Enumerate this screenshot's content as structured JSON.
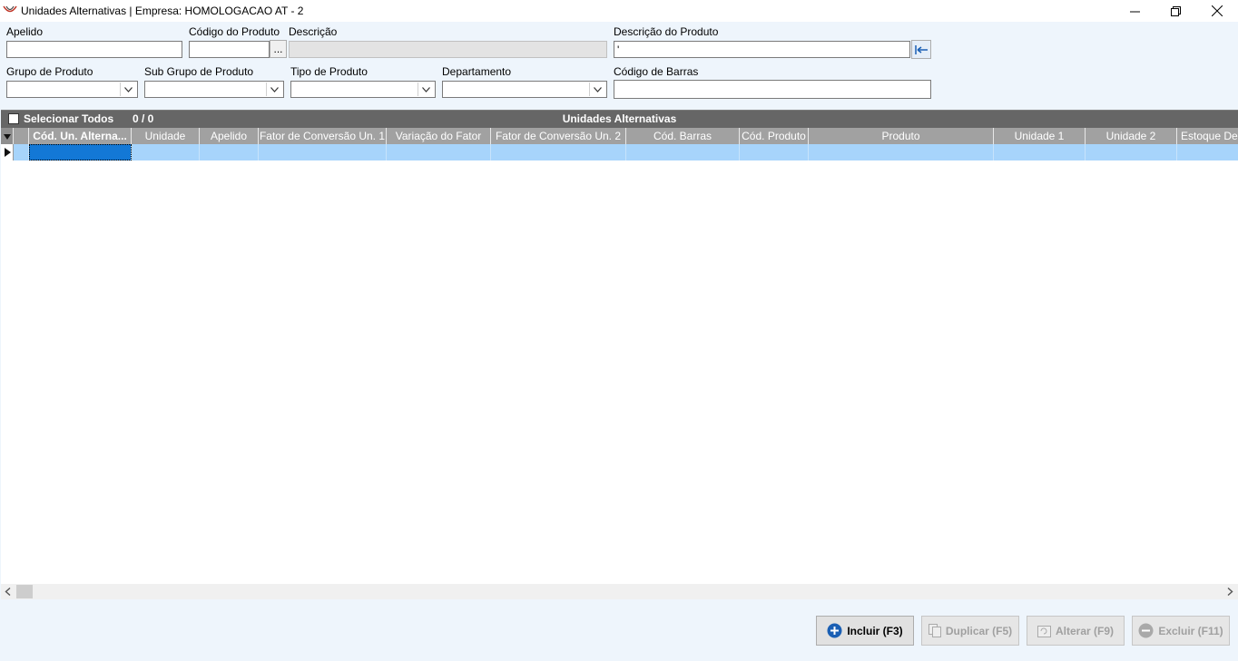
{
  "window": {
    "title": "Unidades Alternativas | Empresa: HOMOLOGACAO AT - 2"
  },
  "filters": {
    "apelido": {
      "label": "Apelido",
      "value": ""
    },
    "codigo_produto": {
      "label": "Código do Produto",
      "value": "",
      "button": "..."
    },
    "descricao": {
      "label": "Descrição",
      "value": ""
    },
    "descricao_produto": {
      "label": "Descrição do Produto",
      "value": "'"
    },
    "grupo_produto": {
      "label": "Grupo de Produto",
      "value": ""
    },
    "sub_grupo_produto": {
      "label": "Sub Grupo de Produto",
      "value": ""
    },
    "tipo_produto": {
      "label": "Tipo de Produto",
      "value": ""
    },
    "departamento": {
      "label": "Departamento",
      "value": ""
    },
    "codigo_barras": {
      "label": "Código de Barras",
      "value": ""
    }
  },
  "grid": {
    "select_all_label": "Selecionar Todos",
    "selection_count": "0 / 0",
    "caption": "Unidades Alternativas",
    "columns": [
      "Cód. Un. Alterna...",
      "Unidade",
      "Apelido",
      "Fator de Conversão Un. 1",
      "Variação do Fator",
      "Fator de Conversão Un. 2",
      "Cód. Barras",
      "Cód. Produto",
      "Produto",
      "Unidade 1",
      "Unidade 2",
      "Estoque Dem"
    ]
  },
  "buttons": {
    "incluir": "Incluir (F3)",
    "duplicar": "Duplicar (F5)",
    "alterar": "Alterar (F9)",
    "excluir": "Excluir (F11)"
  },
  "colors": {
    "accent": "#1a5fb4",
    "header_bg": "#a1a1a1",
    "selected_row": "#a7d4fb"
  }
}
